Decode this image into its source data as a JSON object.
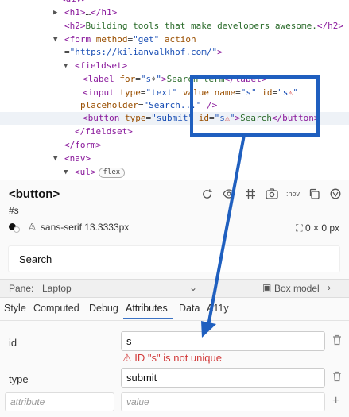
{
  "dom": {
    "line0": {
      "open": "<",
      "tag": "div",
      "close": ">"
    },
    "line1": {
      "tag": "h1",
      "ellipsis": "…",
      "close_tag": "h1"
    },
    "line2": {
      "tag": "h2",
      "text": "Building tools that make developers awesome.",
      "close_tag": "h2"
    },
    "line3": {
      "tag": "form",
      "attr1": "method",
      "val1": "\"get\"",
      "attr2": "action"
    },
    "line4": {
      "eq": "=",
      "q1": "\"",
      "url": "https://kilianvalkhof.com/",
      "q2": "\""
    },
    "line5": {
      "tag": "fieldset"
    },
    "line6": {
      "tag": "label",
      "attr": "for",
      "val": "\"s",
      "val_end": "\"",
      "text": "Search term",
      "close_tag": "label"
    },
    "line7": {
      "tag": "input",
      "attr1": "type",
      "val1": "\"text\"",
      "attr2": "value",
      "attr3": "name",
      "val3": "\"s\"",
      "attr4": "id",
      "val4": "\"s",
      "val4_end": "\""
    },
    "line8": {
      "attr": "placeholder",
      "val": "\"Search...\"",
      "end": "/>"
    },
    "line9": {
      "tag": "button",
      "attr1": "type",
      "val1": "\"submit\"",
      "attr2": "id",
      "val2": "\"s",
      "val2_end": "\"",
      "text": "Search",
      "close_tag": "button"
    },
    "line10": {
      "close_tag": "fieldset"
    },
    "line11": {
      "close_tag": "form"
    },
    "line12": {
      "tag": "nav"
    },
    "line13": {
      "tag": "ul",
      "badge": "flex"
    }
  },
  "inspector": {
    "element_title": "<button>",
    "selector": "#s",
    "font": "sans-serif 13.3333px",
    "size": "0 × 0 px",
    "preview_text": "Search",
    "toolbar": [
      "refresh-icon",
      "eye-icon",
      "grid-icon",
      "camera-icon",
      ":hov",
      "copy-icon",
      "palette-icon"
    ]
  },
  "pane": {
    "label": "Pane:",
    "value": "Laptop",
    "box_model": "Box model"
  },
  "tabs": [
    "Style",
    "Computed",
    "Debug",
    "Attributes",
    "Data",
    "A11y"
  ],
  "active_tab": "Attributes",
  "attributes": [
    {
      "name": "id",
      "value": "s",
      "error": "ID \"s\" is not unique"
    },
    {
      "name": "type",
      "value": "submit"
    }
  ],
  "new_attribute": {
    "name_placeholder": "attribute",
    "value_placeholder": "value",
    "add": "+"
  },
  "colors": {
    "accent": "#3b72c4",
    "error": "#d23b3b",
    "annotation": "#1f5fbf"
  }
}
